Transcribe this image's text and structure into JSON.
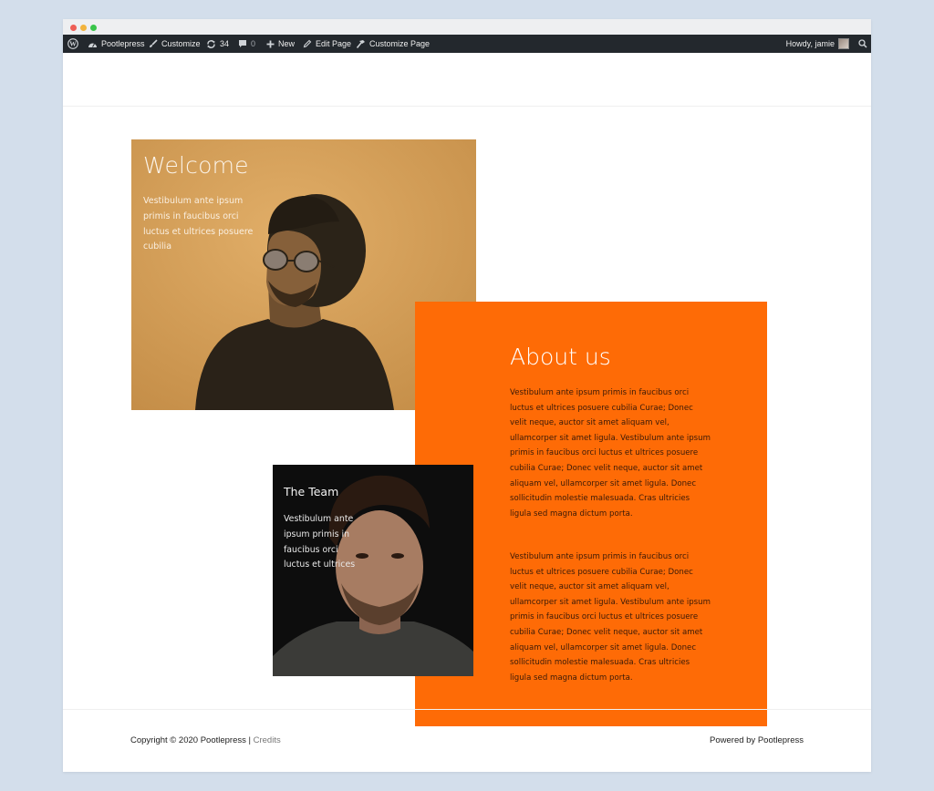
{
  "adminbar": {
    "site_name": "Pootlepress",
    "customize": "Customize",
    "updates_count": "34",
    "comments_count": "0",
    "new_label": "New",
    "edit_page": "Edit Page",
    "customize_page": "Customize Page",
    "howdy": "Howdy, jamie",
    "icons": [
      "wordpress-icon",
      "dashboard-icon",
      "brush-icon",
      "updates-icon",
      "comment-icon",
      "plus-icon",
      "pencil-icon",
      "hammer-icon",
      "avatar",
      "search-icon"
    ]
  },
  "welcome": {
    "title": "Welcome",
    "text": "Vestibulum ante ipsum primis in faucibus orci luctus et ultrices posuere cubilia"
  },
  "about": {
    "title": "About us",
    "paragraph1": "Vestibulum ante ipsum primis in faucibus orci luctus et ultrices posuere cubilia Curae; Donec velit neque, auctor sit amet aliquam vel, ullamcorper sit amet ligula. Vestibulum ante ipsum primis in faucibus orci luctus et ultrices posuere cubilia Curae; Donec velit neque, auctor sit amet aliquam vel, ullamcorper sit amet ligula. Donec sollicitudin molestie malesuada. Cras ultricies ligula sed magna dictum porta.",
    "paragraph2": "Vestibulum ante ipsum primis in faucibus orci luctus et ultrices posuere cubilia Curae; Donec velit neque, auctor sit amet aliquam vel, ullamcorper sit amet ligula. Vestibulum ante ipsum primis in faucibus orci luctus et ultrices posuere cubilia Curae; Donec velit neque, auctor sit amet aliquam vel, ullamcorper sit amet ligula. Donec sollicitudin molestie malesuada. Cras ultricies ligula sed magna dictum porta."
  },
  "team": {
    "title": "The Team",
    "text": "Vestibulum ante ipsum primis in faucibus orci luctus et ultrices"
  },
  "footer": {
    "copyright": "Copyright © 2020 Pootlepress | ",
    "credits": "Credits",
    "powered_by": "Powered by Pootlepress"
  },
  "colors": {
    "background": "#d3deeb",
    "adminbar": "#23282d",
    "welcome_block": "#d7a15a",
    "about_block": "#fe6b06",
    "team_block": "#0f0f0f"
  }
}
